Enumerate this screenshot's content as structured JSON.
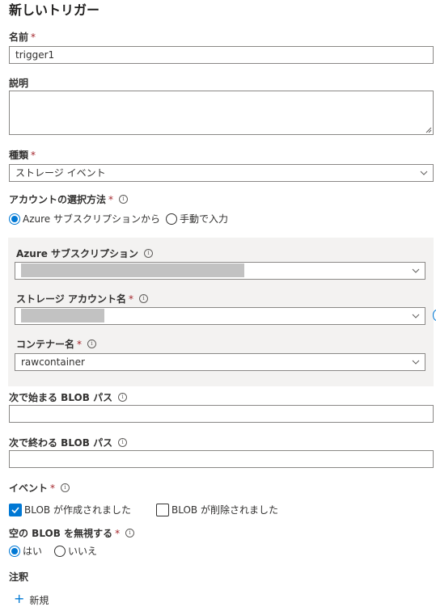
{
  "title": "新しいトリガー",
  "name": {
    "label": "名前",
    "required": "*",
    "value": "trigger1"
  },
  "description": {
    "label": "説明",
    "value": ""
  },
  "type": {
    "label": "種類",
    "required": "*",
    "value": "ストレージ イベント"
  },
  "account_selection": {
    "label": "アカウントの選択方法",
    "required": "*",
    "options": [
      "Azure サブスクリプションから",
      "手動で入力"
    ],
    "selected_index": 0
  },
  "azure_subscription": {
    "label": "Azure サブスクリプション",
    "value": ""
  },
  "storage_account": {
    "label": "ストレージ アカウント名",
    "required": "*",
    "value": ""
  },
  "container": {
    "label": "コンテナー名",
    "required": "*",
    "value": "rawcontainer"
  },
  "blob_begins": {
    "label": "次で始まる BLOB パス",
    "value": ""
  },
  "blob_ends": {
    "label": "次で終わる BLOB パス",
    "value": ""
  },
  "events": {
    "label": "イベント",
    "required": "*",
    "options": [
      {
        "label": "BLOB が作成されました",
        "checked": true
      },
      {
        "label": "BLOB が削除されました",
        "checked": false
      }
    ]
  },
  "ignore_empty": {
    "label": "空の BLOB を無視する",
    "required": "*",
    "options": [
      "はい",
      "いいえ"
    ],
    "selected_index": 0
  },
  "annotations": {
    "label": "注釈",
    "new_label": "新規"
  },
  "colors": {
    "accent": "#0078d4",
    "required": "#a4262c",
    "panel": "#f3f2f1",
    "redaction": "#c2c2c2"
  },
  "icons": {
    "info": "info-icon",
    "chevron": "chevron-down-icon",
    "check": "checkmark-icon",
    "plus": "plus-icon"
  }
}
